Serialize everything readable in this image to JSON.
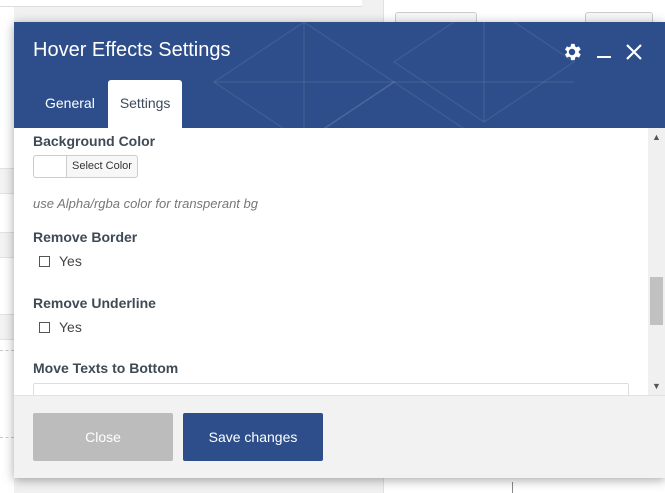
{
  "modal": {
    "title": "Hover Effects Settings",
    "icons": {
      "settings": "gear-icon",
      "minimize": "minimize-icon",
      "close": "close-icon"
    }
  },
  "tabs": [
    {
      "label": "General",
      "active": false
    },
    {
      "label": "Settings",
      "active": true
    }
  ],
  "fields": {
    "background_color": {
      "label": "Background Color",
      "button_label": "Select Color",
      "hint": "use Alpha/rgba color for transperant bg"
    },
    "remove_border": {
      "label": "Remove Border",
      "option_label": "Yes",
      "checked": false
    },
    "remove_underline": {
      "label": "Remove Underline",
      "option_label": "Yes",
      "checked": false
    },
    "move_texts_bottom": {
      "label": "Move Texts to Bottom",
      "value": ""
    }
  },
  "footer": {
    "close_label": "Close",
    "save_label": "Save changes"
  },
  "colors": {
    "header": "#2d4e8a",
    "save_button": "#2d4e8a",
    "close_button": "#bcbcbc"
  }
}
